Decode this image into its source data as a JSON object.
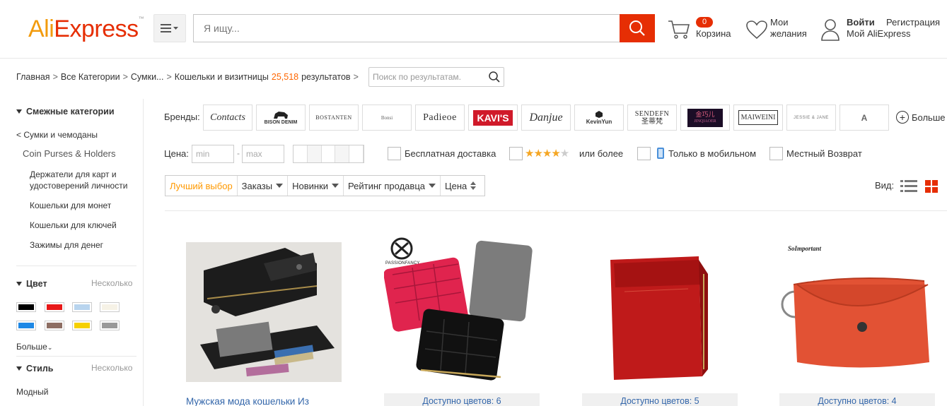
{
  "header": {
    "logo": {
      "part1": "Ali",
      "part2": "Express",
      "tm": "™"
    },
    "search_placeholder": "Я ищу...",
    "cart": {
      "count": "0",
      "label": "Корзина"
    },
    "wishlist": {
      "line1": "Мои",
      "line2": "желания"
    },
    "account": {
      "login": "Войти",
      "register": "Регистрация",
      "my": "Мой AliExpress"
    }
  },
  "breadcrumb": {
    "items": [
      "Главная",
      "Все Категории",
      "Сумки...",
      "Кошельки и визитницы"
    ],
    "count": "25,518",
    "results_label": "результатов",
    "refine_placeholder": "Поиск по результатам."
  },
  "sidebar": {
    "related_title": "Смежные категории",
    "parent": "< Сумки и чемоданы",
    "current": "Coin Purses & Holders",
    "subcats": [
      "Держатели для карт и удостоверений личности",
      "Кошельки для монет",
      "Кошельки для ключей",
      "Зажимы для денег"
    ],
    "color_title": "Цвет",
    "multi_label": "Несколько",
    "colors": [
      "#000000",
      "#e81818",
      "#b8d4ee",
      "#f6f2e6",
      "#1e88e5",
      "#8d6e63",
      "#f5d000",
      "#999999"
    ],
    "more": "Больше",
    "style_title": "Стиль",
    "style_first": "Модный"
  },
  "filters": {
    "brands_label": "Бренды:",
    "brands": [
      "Contacts",
      "BISON DENIM",
      "BOSTANTEN",
      "Bonsi",
      "Padieoe",
      "KAVI'S",
      "Danjue",
      "KevinYun",
      "SENDEFN",
      "JINQIAOER",
      "MAIWEINI",
      "JESSIE & JANE",
      "A"
    ],
    "brands_cn": {
      "sendefn": "圣蒂梵",
      "jinqiaoer": "金巧儿"
    },
    "more_brands": "Больше",
    "price_label": "Цена:",
    "min_placeholder": "min",
    "max_placeholder": "max",
    "free_shipping": "Бесплатная доставка",
    "rating": {
      "stars": 4,
      "label": "или более"
    },
    "mobile_only": "Только в мобильном",
    "local_return": "Местный Возврат"
  },
  "sort": {
    "items": [
      "Лучший выбор",
      "Заказы",
      "Новинки",
      "Рейтинг продавца",
      "Цена"
    ],
    "view_label": "Вид:"
  },
  "products": [
    {
      "title": "Мужская мода кошельки Из"
    },
    {
      "brand": "PASSIONFANCY",
      "colors": "Доступно цветов: 6"
    },
    {
      "colors": "Доступно цветов: 5"
    },
    {
      "brand": "SoImportant",
      "colors": "Доступно цветов: 4"
    }
  ],
  "colors": {
    "accent": "#e62e04",
    "orange": "#ff6600",
    "link": "#3366aa"
  }
}
